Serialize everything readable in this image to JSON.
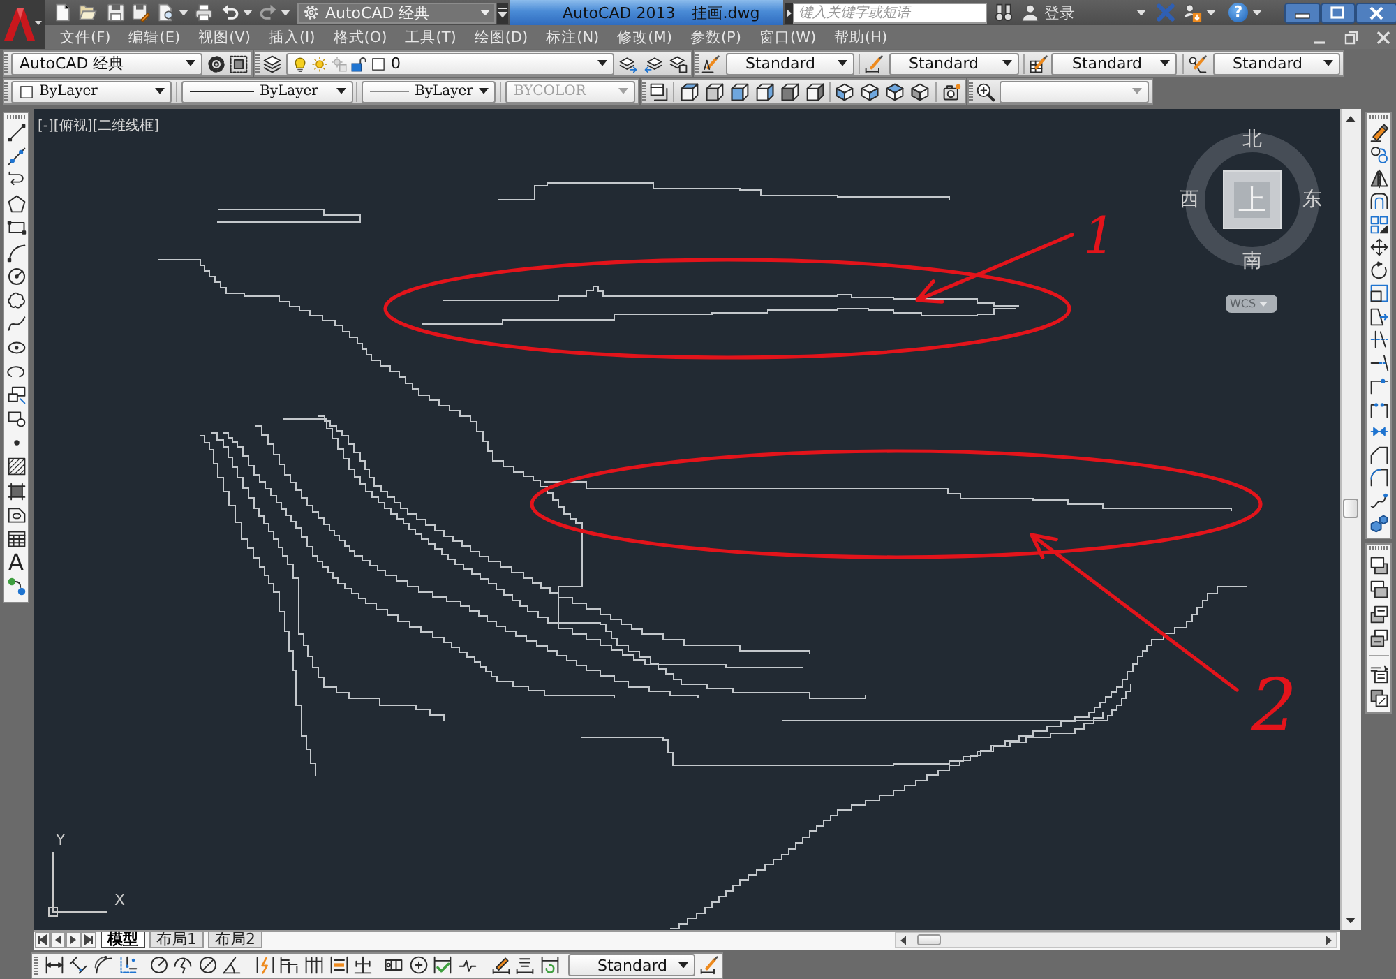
{
  "title_bar": {
    "workspace": "AutoCAD 经典",
    "app_title": "AutoCAD 2013",
    "file_name": "挂画.dwg",
    "search": {
      "placeholder": "键入关键字或短语"
    },
    "sign_in": "登录",
    "help": "?"
  },
  "menu_bar": [
    "文件(F)",
    "编辑(E)",
    "视图(V)",
    "插入(I)",
    "格式(O)",
    "工具(T)",
    "绘图(D)",
    "标注(N)",
    "修改(M)",
    "参数(P)",
    "窗口(W)",
    "帮助(H)"
  ],
  "styles_toolbar": {
    "workspace": "AutoCAD 经典",
    "layer": {
      "name": "0",
      "on": true,
      "frozen": false,
      "locked": false
    },
    "text_style": "Standard",
    "dimension_style": "Standard",
    "table_style": "Standard",
    "multileader_style": "Standard"
  },
  "properties_toolbar": {
    "color_control": "ByLayer",
    "linetype": "ByLayer",
    "lineweight": "ByLayer",
    "plot_style": {
      "value": "BYCOLOR",
      "disabled": true
    }
  },
  "draw_toolbar": {
    "text_tool": "A"
  },
  "viewport": {
    "label": "[-][俯视][二维线框]",
    "viewcube": {
      "north": "北",
      "east": "东",
      "south": "南",
      "west": "西",
      "face": "上",
      "ucs_menu": "WCS"
    },
    "ucs_icon": {
      "x_label": "X",
      "y_label": "Y"
    },
    "annotations": [
      "1",
      "2"
    ]
  },
  "layout_tabs": [
    {
      "label": "模型",
      "selected": true
    },
    {
      "label": "布局1",
      "selected": false
    },
    {
      "label": "布局2",
      "selected": false
    }
  ],
  "dimension_toolbar": {
    "dimension_style": "Standard"
  }
}
